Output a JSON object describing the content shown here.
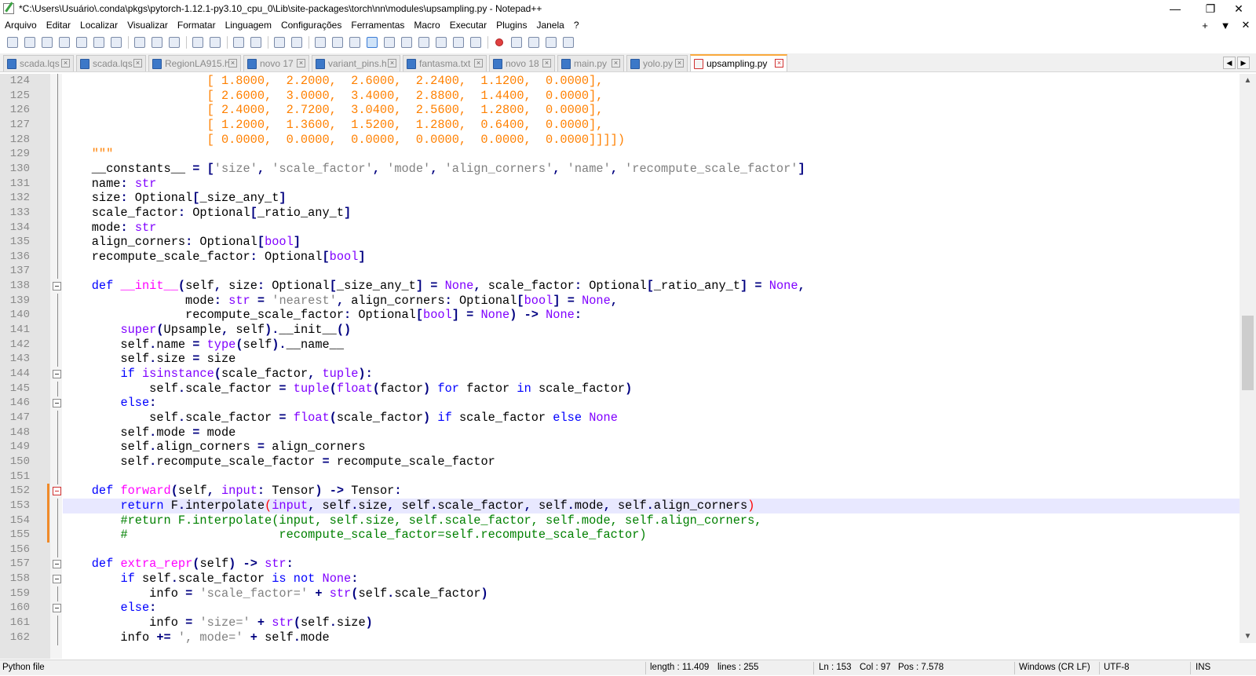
{
  "window": {
    "title": "*C:\\Users\\Usuário\\.conda\\pkgs\\pytorch-1.12.1-py3.10_cpu_0\\Lib\\site-packages\\torch\\nn\\modules\\upsampling.py - Notepad++",
    "minimize": "—",
    "restore": "❐",
    "close": "✕"
  },
  "menu": {
    "items": [
      "Arquivo",
      "Editar",
      "Localizar",
      "Visualizar",
      "Formatar",
      "Linguagem",
      "Configurações",
      "Ferramentas",
      "Macro",
      "Executar",
      "Plugins",
      "Janela",
      "?"
    ],
    "right": [
      "+",
      "▼",
      "✕"
    ]
  },
  "toolbar": {
    "icons": [
      "new-file-icon",
      "open-file-icon",
      "save-icon",
      "save-all-icon",
      "close-icon",
      "close-all-icon",
      "print-icon",
      "sep",
      "cut-icon",
      "copy-icon",
      "paste-icon",
      "sep",
      "undo-icon",
      "redo-icon",
      "sep",
      "find-icon",
      "replace-icon",
      "sep",
      "zoom-in-icon",
      "zoom-out-icon",
      "sep",
      "sync-vertical-icon",
      "sync-horizontal-icon",
      "word-wrap-icon",
      "show-all-chars-icon",
      "indent-guide-icon",
      "language-icon",
      "doc-map-icon",
      "function-list-icon",
      "folder-workspace-icon",
      "monitoring-icon",
      "sep",
      "record-macro-icon",
      "stop-record-icon",
      "play-macro-icon",
      "run-macro-multiple-icon",
      "save-macro-icon"
    ]
  },
  "tabs": [
    {
      "label": "scada.lqs",
      "active": false
    },
    {
      "label": "scada.lqs",
      "active": false
    },
    {
      "label": "RegionLA915.h",
      "active": false
    },
    {
      "label": "novo 17",
      "active": false
    },
    {
      "label": "variant_pins.h",
      "active": false
    },
    {
      "label": "fantasma.txt",
      "active": false
    },
    {
      "label": "novo 18",
      "active": false
    },
    {
      "label": "main.py",
      "active": false
    },
    {
      "label": "yolo.py",
      "active": false
    },
    {
      "label": "upsampling.py",
      "active": true
    }
  ],
  "tabnav": [
    "◀",
    "▶"
  ],
  "editor": {
    "current_line": 153,
    "lines": [
      {
        "n": "124",
        "html": "                    <span class=\"ok\">[ 1.8000,  2.2000,  2.6000,  2.2400,  1.1200,  0.0000],</span>"
      },
      {
        "n": "125",
        "html": "                    <span class=\"ok\">[ 2.6000,  3.0000,  3.4000,  2.8800,  1.4400,  0.0000],</span>"
      },
      {
        "n": "126",
        "html": "                    <span class=\"ok\">[ 2.4000,  2.7200,  3.0400,  2.5600,  1.2800,  0.0000],</span>"
      },
      {
        "n": "127",
        "html": "                    <span class=\"ok\">[ 1.2000,  1.3600,  1.5200,  1.2800,  0.6400,  0.0000],</span>"
      },
      {
        "n": "128",
        "html": "                    <span class=\"ok\">[ 0.0000,  0.0000,  0.0000,  0.0000,  0.0000,  0.0000]]]])</span>"
      },
      {
        "n": "129",
        "html": "    <span class=\"tq\">\"\"\"</span>"
      },
      {
        "n": "130",
        "html": "    __constants__ <span class=\"op\">=</span> <span class=\"op\">[</span><span class=\"str\">'size'</span><span class=\"op\">,</span> <span class=\"str\">'scale_factor'</span><span class=\"op\">,</span> <span class=\"str\">'mode'</span><span class=\"op\">,</span> <span class=\"str\">'align_corners'</span><span class=\"op\">,</span> <span class=\"str\">'name'</span><span class=\"op\">,</span> <span class=\"str\">'recompute_scale_factor'</span><span class=\"op\">]</span>"
      },
      {
        "n": "131",
        "html": "    name<span class=\"op\">:</span> <span class=\"bi\">str</span>"
      },
      {
        "n": "132",
        "html": "    size<span class=\"op\">:</span> Optional<span class=\"op\">[</span>_size_any_t<span class=\"op\">]</span>"
      },
      {
        "n": "133",
        "html": "    scale_factor<span class=\"op\">:</span> Optional<span class=\"op\">[</span>_ratio_any_t<span class=\"op\">]</span>"
      },
      {
        "n": "134",
        "html": "    mode<span class=\"op\">:</span> <span class=\"bi\">str</span>"
      },
      {
        "n": "135",
        "html": "    align_corners<span class=\"op\">:</span> Optional<span class=\"op\">[</span><span class=\"bi\">bool</span><span class=\"op\">]</span>"
      },
      {
        "n": "136",
        "html": "    recompute_scale_factor<span class=\"op\">:</span> Optional<span class=\"op\">[</span><span class=\"bi\">bool</span><span class=\"op\">]</span>"
      },
      {
        "n": "137",
        "html": ""
      },
      {
        "n": "138",
        "html": "    <span class=\"kw\">def</span> <span class=\"fn\">__init__</span><span class=\"op\">(</span>self<span class=\"op\">,</span> size<span class=\"op\">:</span> Optional<span class=\"op\">[</span>_size_any_t<span class=\"op\">]</span> <span class=\"op\">=</span> <span class=\"bi\">None</span><span class=\"op\">,</span> scale_factor<span class=\"op\">:</span> Optional<span class=\"op\">[</span>_ratio_any_t<span class=\"op\">]</span> <span class=\"op\">=</span> <span class=\"bi\">None</span><span class=\"op\">,</span>"
      },
      {
        "n": "139",
        "html": "                 mode<span class=\"op\">:</span> <span class=\"bi\">str</span> <span class=\"op\">=</span> <span class=\"str\">'nearest'</span><span class=\"op\">,</span> align_corners<span class=\"op\">:</span> Optional<span class=\"op\">[</span><span class=\"bi\">bool</span><span class=\"op\">]</span> <span class=\"op\">=</span> <span class=\"bi\">None</span><span class=\"op\">,</span>"
      },
      {
        "n": "140",
        "html": "                 recompute_scale_factor<span class=\"op\">:</span> Optional<span class=\"op\">[</span><span class=\"bi\">bool</span><span class=\"op\">]</span> <span class=\"op\">=</span> <span class=\"bi\">None</span><span class=\"op\">)</span> <span class=\"op\">-&gt;</span> <span class=\"bi\">None</span><span class=\"op\">:</span>"
      },
      {
        "n": "141",
        "html": "        <span class=\"bi\">super</span><span class=\"op\">(</span>Upsample<span class=\"op\">,</span> self<span class=\"op\">).</span>__init__<span class=\"op\">()</span>"
      },
      {
        "n": "142",
        "html": "        self<span class=\"op\">.</span>name <span class=\"op\">=</span> <span class=\"bi\">type</span><span class=\"op\">(</span>self<span class=\"op\">).</span>__name__"
      },
      {
        "n": "143",
        "html": "        self<span class=\"op\">.</span>size <span class=\"op\">=</span> size"
      },
      {
        "n": "144",
        "html": "        <span class=\"kw\">if</span> <span class=\"bi\">isinstance</span><span class=\"op\">(</span>scale_factor<span class=\"op\">,</span> <span class=\"bi\">tuple</span><span class=\"op\">):</span>"
      },
      {
        "n": "145",
        "html": "            self<span class=\"op\">.</span>scale_factor <span class=\"op\">=</span> <span class=\"bi\">tuple</span><span class=\"op\">(</span><span class=\"bi\">float</span><span class=\"op\">(</span>factor<span class=\"op\">)</span> <span class=\"kw\">for</span> factor <span class=\"kw\">in</span> scale_factor<span class=\"op\">)</span>"
      },
      {
        "n": "146",
        "html": "        <span class=\"kw\">else</span><span class=\"op\">:</span>"
      },
      {
        "n": "147",
        "html": "            self<span class=\"op\">.</span>scale_factor <span class=\"op\">=</span> <span class=\"bi\">float</span><span class=\"op\">(</span>scale_factor<span class=\"op\">)</span> <span class=\"kw\">if</span> scale_factor <span class=\"kw\">else</span> <span class=\"bi\">None</span>"
      },
      {
        "n": "148",
        "html": "        self<span class=\"op\">.</span>mode <span class=\"op\">=</span> mode"
      },
      {
        "n": "149",
        "html": "        self<span class=\"op\">.</span>align_corners <span class=\"op\">=</span> align_corners"
      },
      {
        "n": "150",
        "html": "        self<span class=\"op\">.</span>recompute_scale_factor <span class=\"op\">=</span> recompute_scale_factor"
      },
      {
        "n": "151",
        "html": ""
      },
      {
        "n": "152",
        "html": "    <span class=\"kw\">def</span> <span class=\"fn\">forward</span><span class=\"op\">(</span>self<span class=\"op\">,</span> <span class=\"bi\">input</span><span class=\"op\">:</span> Tensor<span class=\"op\">)</span> <span class=\"op\">-&gt;</span> Tensor<span class=\"op\">:</span>"
      },
      {
        "n": "153",
        "html": "        <span class=\"kw\">return</span> F<span class=\"op\">.</span>interpolate<span style=\"color:#ff0000\">(</span><span class=\"bi\">input</span><span class=\"op\">,</span> self<span class=\"op\">.</span>size<span class=\"op\">,</span> self<span class=\"op\">.</span>scale_factor<span class=\"op\">,</span> self<span class=\"op\">.</span>mode<span class=\"op\">,</span> self<span class=\"op\">.</span>align_corners<span style=\"color:#ff0000\">)</span>"
      },
      {
        "n": "154",
        "html": "        <span class=\"cm\">#return F.interpolate(input, self.size, self.scale_factor, self.mode, self.align_corners,</span>"
      },
      {
        "n": "155",
        "html": "        <span class=\"cm\">#                     recompute_scale_factor=self.recompute_scale_factor)</span>"
      },
      {
        "n": "156",
        "html": ""
      },
      {
        "n": "157",
        "html": "    <span class=\"kw\">def</span> <span class=\"fn\">extra_repr</span><span class=\"op\">(</span>self<span class=\"op\">)</span> <span class=\"op\">-&gt;</span> <span class=\"bi\">str</span><span class=\"op\">:</span>"
      },
      {
        "n": "158",
        "html": "        <span class=\"kw\">if</span> self<span class=\"op\">.</span>scale_factor <span class=\"kw\">is</span> <span class=\"kw\">not</span> <span class=\"bi\">None</span><span class=\"op\">:</span>"
      },
      {
        "n": "159",
        "html": "            info <span class=\"op\">=</span> <span class=\"str\">'scale_factor='</span> <span class=\"op\">+</span> <span class=\"bi\">str</span><span class=\"op\">(</span>self<span class=\"op\">.</span>scale_factor<span class=\"op\">)</span>"
      },
      {
        "n": "160",
        "html": "        <span class=\"kw\">else</span><span class=\"op\">:</span>"
      },
      {
        "n": "161",
        "html": "            info <span class=\"op\">=</span> <span class=\"str\">'size='</span> <span class=\"op\">+</span> <span class=\"bi\">str</span><span class=\"op\">(</span>self<span class=\"op\">.</span>size<span class=\"op\">)</span>"
      },
      {
        "n": "162",
        "html": "        info <span class=\"op\">+=</span> <span class=\"str\">', mode='</span> <span class=\"op\">+</span> self<span class=\"op\">.</span>mode"
      }
    ]
  },
  "status": {
    "filetype": "Python file",
    "length": "length : 11.409",
    "lines": "lines : 255",
    "ln": "Ln : 153",
    "col": "Col : 97",
    "pos": "Pos : 7.578",
    "eol": "Windows (CR LF)",
    "encoding": "UTF-8",
    "mode": "INS"
  },
  "scroll": {
    "up": "▲",
    "down": "▼"
  }
}
